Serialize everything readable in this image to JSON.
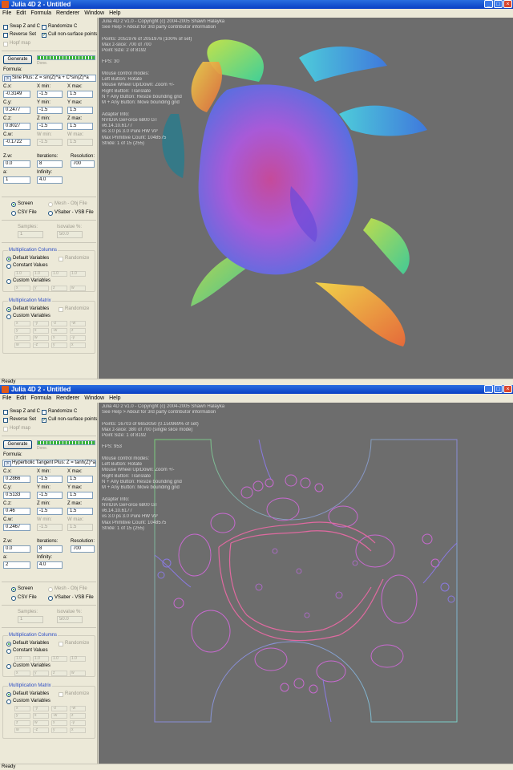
{
  "windows": [
    {
      "title": "Julia 4D 2 - Untitled",
      "menu": [
        "File",
        "Edit",
        "Formula",
        "Renderer",
        "Window",
        "Help"
      ],
      "checks": {
        "swap_z_c": {
          "label": "Swap Z and C",
          "checked": false
        },
        "randomize_c": {
          "label": "Randomize C",
          "checked": false
        },
        "reverse_set": {
          "label": "Reverse Set",
          "checked": false
        },
        "cull": {
          "label": "Cull non-surface points",
          "checked": true
        },
        "hopf": {
          "label": "Hopf map",
          "checked": false
        }
      },
      "generate_label": "Generate",
      "progress": 1.0,
      "progress_text": "Done.",
      "formula_label": "Formula:",
      "formula_arrow": ">",
      "formula_value": "Sine Plus: Z = sin(Z)^a + C*sin(Z)^a",
      "fields": {
        "cx": {
          "label": "C.x:",
          "value": "-0.3149"
        },
        "cy": {
          "label": "C.y:",
          "value": "0.2477"
        },
        "cz": {
          "label": "C.z:",
          "value": "0.8027"
        },
        "cw": {
          "label": "C.w:",
          "value": "-0.1722"
        },
        "xmin": {
          "label": "X min:",
          "value": "-1.5"
        },
        "xmax": {
          "label": "X max:",
          "value": "1.5"
        },
        "ymin": {
          "label": "Y min:",
          "value": "-1.5"
        },
        "ymax": {
          "label": "Y max:",
          "value": "1.5"
        },
        "zmin": {
          "label": "Z min:",
          "value": "-1.5"
        },
        "zmax": {
          "label": "Z max:",
          "value": "1.5"
        },
        "wmin": {
          "label": "W min:",
          "value": "-1.5"
        },
        "wmax": {
          "label": "W max:",
          "value": "1.5"
        },
        "zw": {
          "label": "Z.w:",
          "value": "0.0"
        },
        "iterations": {
          "label": "Iterations:",
          "value": "8"
        },
        "resolution": {
          "label": "Resolution:",
          "value": "700"
        },
        "a": {
          "label": "a:",
          "value": "1"
        },
        "infinity": {
          "label": "Infinity:",
          "value": "4.0"
        }
      },
      "output": {
        "screen": {
          "label": "Screen",
          "selected": true
        },
        "mesh": {
          "label": "Mesh - Obj File",
          "selected": false
        },
        "csv": {
          "label": "CSV File",
          "selected": false
        },
        "vsaber": {
          "label": "VSaber - VSB File",
          "selected": false
        }
      },
      "samples": {
        "label": "Samples:",
        "value": "1"
      },
      "isovalue": {
        "label": "Isovalue %:",
        "value": "50.0"
      },
      "mult_columns": {
        "title": "Multiplication Columns",
        "default_vars": "Default Variables",
        "randomize": "Randomize",
        "constant_vals": "Constant Values",
        "custom_vars": "Custom Variables",
        "constants": [
          "1.0",
          "1.0",
          "1.0",
          "1.0"
        ],
        "custom": [
          "x",
          "y",
          "z",
          "w"
        ]
      },
      "mult_matrix": {
        "title": "Multiplication Matrix",
        "default_vars": "Default Variables",
        "randomize": "Randomize",
        "custom_vars": "Custom Variables",
        "cells": [
          "x",
          "-y",
          "-z",
          "-w",
          "y",
          "x",
          "-w",
          "z",
          "z",
          "w",
          "x",
          "-y",
          "w",
          "-z",
          "y",
          "x"
        ]
      },
      "overlay": {
        "version": "Julia 4D 2 v1.0 - Copyright (c) 2004-2005 Shawn Halayka",
        "help": "See Help > About for 3rd party contributor information",
        "points": "Points: 2051976 of 2051976 (100% of set)",
        "zslice": "Max z-slice: 700 of 700",
        "pointsize": "Point Size: 2 of 8192",
        "fps": "FPS: 30",
        "mouse_title": "Mouse control modes:",
        "mouse": [
          "Left Button: Rotate",
          "Mouse Wheel Up/Down: Zoom +/-",
          "Right Button: Translate",
          "N + Any Button: Resize bounding grid",
          "M + Any Button: Move bounding grid"
        ],
        "adapter_title": "Adapter Info:",
        "adapter": [
          "NVIDIA GeForce 6800 GT",
          "v6.14.10.6177",
          "vs 3.0 ps 3.0 Pure HW VP",
          "Max Primitive Count: 1048575",
          "Stride: 1 of 15 (255)"
        ]
      },
      "status": "Ready",
      "accent": "#0a3fc4"
    },
    {
      "title": "Julia 4D 2 - Untitled",
      "menu": [
        "File",
        "Edit",
        "Formula",
        "Renderer",
        "Window",
        "Help"
      ],
      "checks": {
        "swap_z_c": {
          "label": "Swap Z and C",
          "checked": false
        },
        "randomize_c": {
          "label": "Randomize C",
          "checked": false
        },
        "reverse_set": {
          "label": "Reverse Set",
          "checked": false
        },
        "cull": {
          "label": "Cull non-surface points",
          "checked": true
        },
        "hopf": {
          "label": "Hopf map",
          "checked": false
        }
      },
      "generate_label": "Generate",
      "progress": 1.0,
      "progress_text": "Done.",
      "formula_label": "Formula:",
      "formula_arrow": ">",
      "formula_value": "Hyperbolic Tangent Plus: Z = tanh(Z)^a",
      "fields": {
        "cx": {
          "label": "C.x:",
          "value": "0.2866"
        },
        "cy": {
          "label": "C.y:",
          "value": "0.5133"
        },
        "cz": {
          "label": "C.z:",
          "value": "0.46"
        },
        "cw": {
          "label": "C.w:",
          "value": "0.2467"
        },
        "xmin": {
          "label": "X min:",
          "value": "-1.5"
        },
        "xmax": {
          "label": "X max:",
          "value": "1.5"
        },
        "ymin": {
          "label": "Y min:",
          "value": "-1.5"
        },
        "ymax": {
          "label": "Y max:",
          "value": "1.5"
        },
        "zmin": {
          "label": "Z min:",
          "value": "-1.5"
        },
        "zmax": {
          "label": "Z max:",
          "value": "1.5"
        },
        "wmin": {
          "label": "W min:",
          "value": "-1.5"
        },
        "wmax": {
          "label": "W max:",
          "value": "1.5"
        },
        "zw": {
          "label": "Z.w:",
          "value": "0.0"
        },
        "iterations": {
          "label": "Iterations:",
          "value": "8"
        },
        "resolution": {
          "label": "Resolution:",
          "value": "700"
        },
        "a": {
          "label": "a:",
          "value": "2"
        },
        "infinity": {
          "label": "Infinity:",
          "value": "4.0"
        }
      },
      "output": {
        "screen": {
          "label": "Screen",
          "selected": true
        },
        "mesh": {
          "label": "Mesh - Obj File",
          "selected": false
        },
        "csv": {
          "label": "CSV File",
          "selected": false
        },
        "vsaber": {
          "label": "VSaber - VSB File",
          "selected": false
        }
      },
      "samples": {
        "label": "Samples:",
        "value": "1"
      },
      "isovalue": {
        "label": "Isovalue %:",
        "value": "50.0"
      },
      "mult_columns": {
        "title": "Multiplication Columns",
        "default_vars": "Default Variables",
        "randomize": "Randomize",
        "constant_vals": "Constant Values",
        "custom_vars": "Custom Variables",
        "constants": [
          "1.0",
          "1.0",
          "1.0",
          "1.0"
        ],
        "custom": [
          "x",
          "y",
          "z",
          "w"
        ]
      },
      "mult_matrix": {
        "title": "Multiplication Matrix",
        "default_vars": "Default Variables",
        "randomize": "Randomize",
        "custom_vars": "Custom Variables",
        "cells": [
          "x",
          "-y",
          "-z",
          "-w",
          "y",
          "x",
          "-w",
          "z",
          "z",
          "w",
          "x",
          "-y",
          "w",
          "-z",
          "y",
          "x"
        ]
      },
      "overlay": {
        "version": "Julia 4D 2 v1.0 - Copyright (c) 2004-2005 Shawn Halayka",
        "help": "See Help > About for 3rd party contributor information",
        "points": "Points: 16703 of 6653050 (0.150969% of set)",
        "zslice": "Max z-slice: 380 of 700 (single slice mode)",
        "pointsize": "Point Size: 1 of 8192",
        "fps": "FPS: 953",
        "mouse_title": "Mouse control modes:",
        "mouse": [
          "Left Button: Rotate",
          "Mouse Wheel Up/Down: Zoom +/-",
          "Right Button: Translate",
          "N + Any Button: Resize bounding grid",
          "M + Any Button: Move bounding grid"
        ],
        "adapter_title": "Adapter Info:",
        "adapter": [
          "NVIDIA GeForce 6800 GT",
          "v6.14.10.6177",
          "vs 3.0 ps 3.0 Pure HW VP",
          "Max Primitive Count: 1048575",
          "Stride: 1 of 15 (255)"
        ]
      },
      "status": "Ready",
      "accent": "#0a3fc4"
    }
  ]
}
